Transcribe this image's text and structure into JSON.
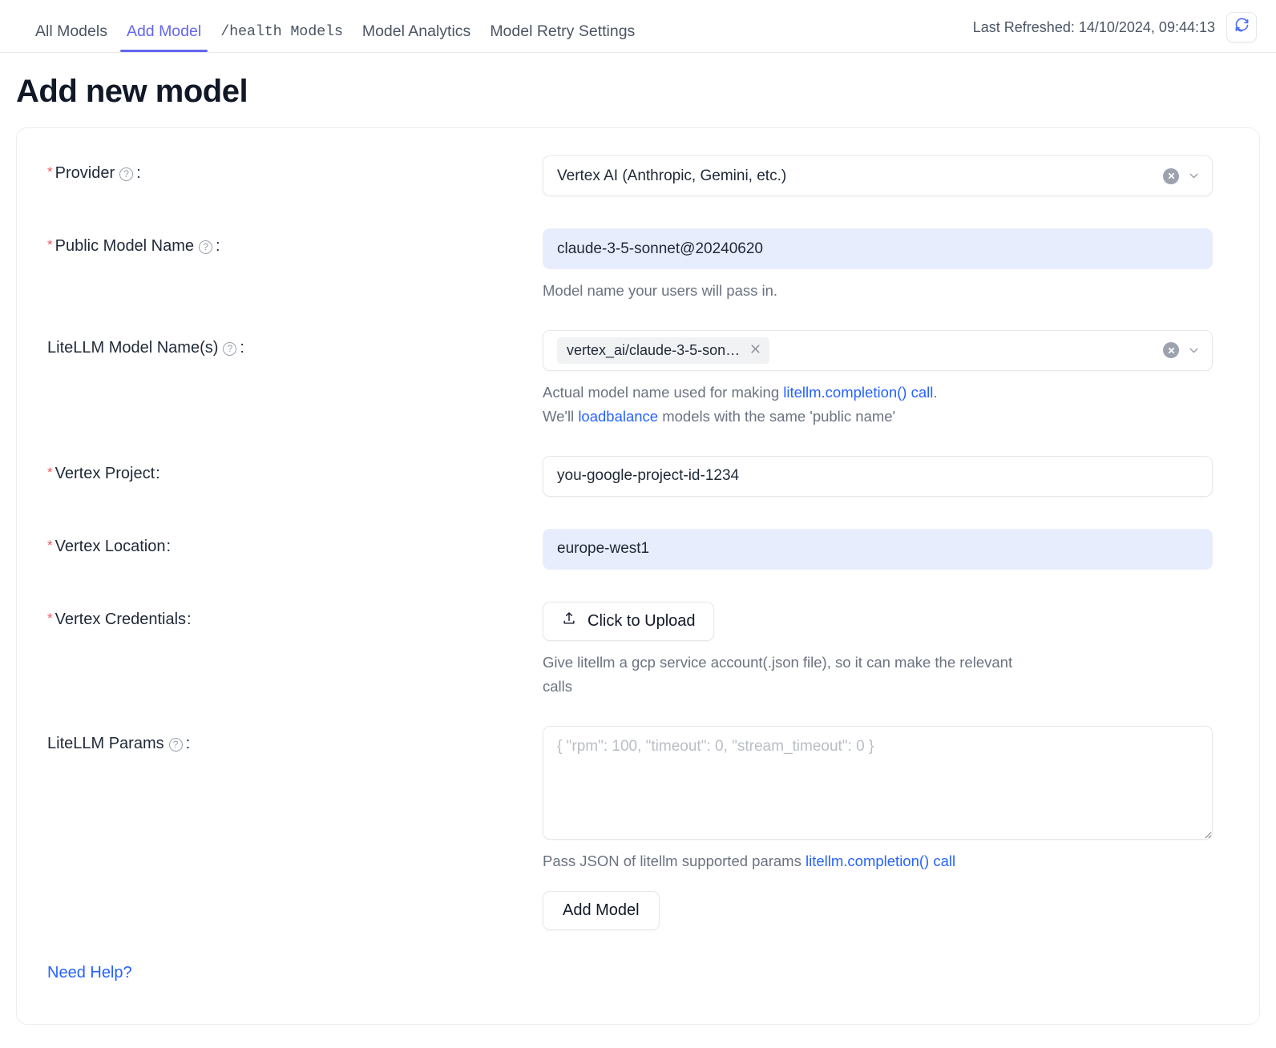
{
  "header": {
    "tabs": [
      {
        "label": "All Models",
        "active": false,
        "mono": false
      },
      {
        "label": "Add Model",
        "active": true,
        "mono": false
      },
      {
        "label": "/health Models",
        "active": false,
        "mono": true
      },
      {
        "label": "Model Analytics",
        "active": false,
        "mono": false
      },
      {
        "label": "Model Retry Settings",
        "active": false,
        "mono": false
      }
    ],
    "last_refreshed": "Last Refreshed: 14/10/2024, 09:44:13",
    "refresh_icon": "refresh-icon"
  },
  "page_title": "Add new model",
  "form": {
    "provider": {
      "label": "Provider",
      "required_mark": "*",
      "colon": ":",
      "help_icon": "question-circle-icon",
      "value": "Vertex AI (Anthropic, Gemini, etc.)",
      "clear_icon": "clear-circle-icon",
      "chevron_icon": "chevron-down-icon"
    },
    "public_model_name": {
      "label": "Public Model Name",
      "required_mark": "*",
      "colon": ":",
      "help_icon": "question-circle-icon",
      "value": "claude-3-5-sonnet@20240620",
      "helper": "Model name your users will pass in."
    },
    "litellm_model_names": {
      "label": "LiteLLM Model Name(s)",
      "colon": ":",
      "help_icon": "question-circle-icon",
      "tag": "vertex_ai/claude-3-5-son…",
      "tag_remove_icon": "close-icon",
      "clear_icon": "clear-circle-icon",
      "chevron_icon": "chevron-down-icon",
      "helper_line1_pre": "Actual model name used for making ",
      "helper_line1_link": "litellm.completion() call",
      "helper_line1_post": ".",
      "helper_line2_pre": "We'll ",
      "helper_line2_link": "loadbalance",
      "helper_line2_post": " models with the same 'public name'"
    },
    "vertex_project": {
      "label": "Vertex Project",
      "required_mark": "*",
      "colon": ":",
      "value": "you-google-project-id-1234"
    },
    "vertex_location": {
      "label": "Vertex Location",
      "required_mark": "*",
      "colon": ":",
      "value": "europe-west1"
    },
    "vertex_credentials": {
      "label": "Vertex Credentials",
      "required_mark": "*",
      "colon": ":",
      "upload_label": "Click to Upload",
      "upload_icon": "upload-icon",
      "helper": "Give litellm a gcp service account(.json file), so it can make the relevant calls"
    },
    "litellm_params": {
      "label": "LiteLLM Params",
      "colon": ":",
      "help_icon": "question-circle-icon",
      "placeholder": "{ \"rpm\": 100, \"timeout\": 0, \"stream_timeout\": 0 }",
      "value": "",
      "helper_pre": "Pass JSON of litellm supported params ",
      "helper_link": "litellm.completion() call"
    },
    "submit_label": "Add Model",
    "need_help_label": "Need Help?"
  },
  "colors": {
    "accent": "#6366f1",
    "link": "#2563ff",
    "required": "#f5555f",
    "autofill_bg": "#e8edfd"
  }
}
